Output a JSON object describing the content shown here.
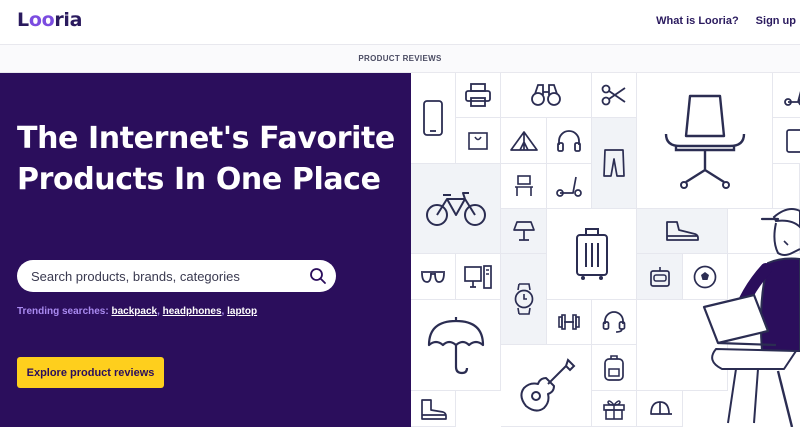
{
  "header": {
    "logo_text": "Looria",
    "nav": [
      "What is Looria?",
      "Sign up"
    ]
  },
  "subnav": {
    "label": "PRODUCT REVIEWS"
  },
  "hero": {
    "title": "The Internet's Favorite Products In One Place",
    "search": {
      "placeholder": "Search products, brands, categories"
    },
    "trending": {
      "label": "Trending searches:",
      "items": [
        "backpack",
        "headphones",
        "laptop"
      ]
    },
    "cta_label": "Explore product reviews"
  },
  "colors": {
    "hero_bg": "#2b0e5c",
    "accent_purple": "#7b4ce0",
    "cta_yellow": "#fecf1d",
    "trending_purple": "#a98af0",
    "grid_shade": "#f1f3f7"
  },
  "icon_grid": [
    "smartphone-icon",
    "printer-icon",
    "binoculars-icon",
    "scissors-icon",
    "office-chair-icon",
    "scooter-icon",
    "bag-icon",
    "tent-icon",
    "headphones-icon",
    "pants-icon",
    "tablet-icon",
    "bicycle-icon",
    "stool-icon",
    "kick-scooter-icon",
    "lamp-icon",
    "suitcase-icon",
    "sneaker-icon",
    "sunglasses-icon",
    "computer-icon",
    "robot-icon",
    "soccer-ball-icon",
    "watch-icon",
    "dumbbell-icon",
    "headset-icon",
    "umbrella-icon",
    "guitar-icon",
    "backpack-icon",
    "boot-icon",
    "gift-icon",
    "cap-icon",
    "person-with-laptop-icon"
  ]
}
